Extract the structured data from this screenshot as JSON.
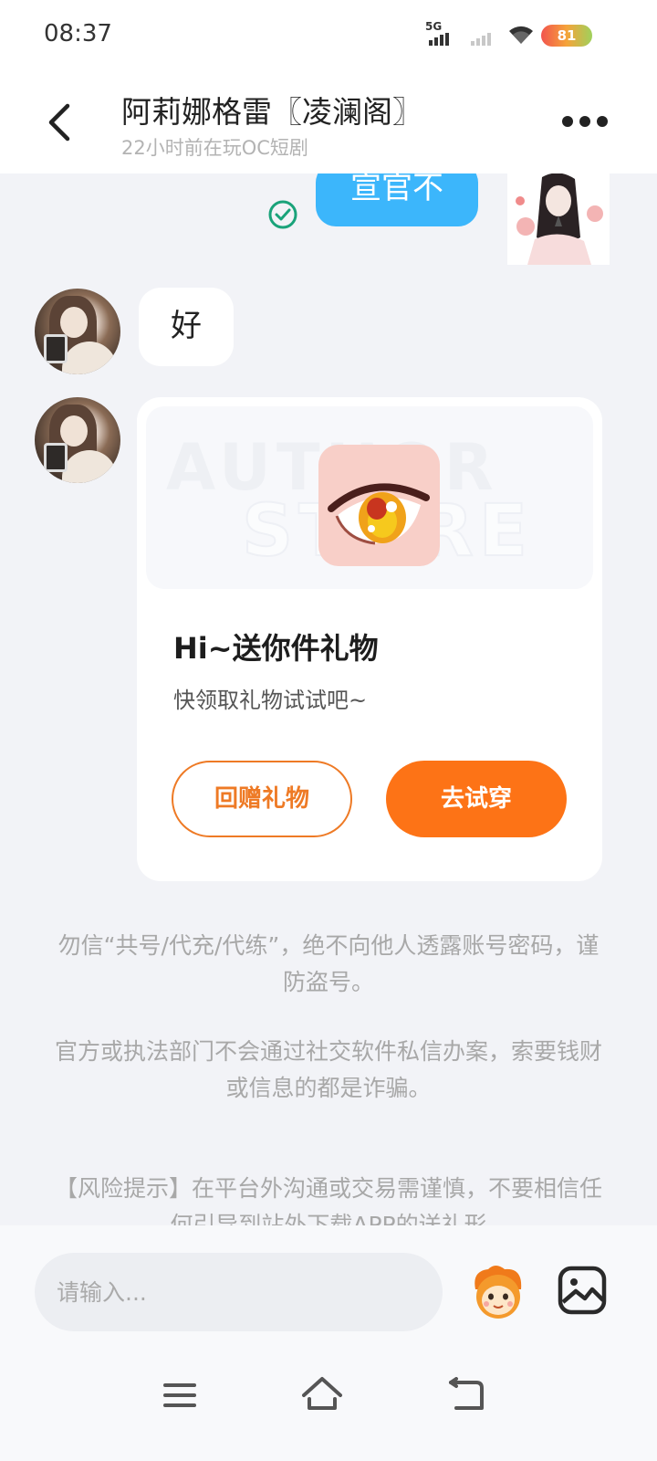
{
  "status_bar": {
    "time": "08:37",
    "network": "5G",
    "battery": "81"
  },
  "header": {
    "title": "阿莉娜格雷〖凌澜阁〗",
    "subtitle": "22小时前在玩OC短剧"
  },
  "messages": {
    "sent_text": "宣官不",
    "received_text": "好"
  },
  "gift_card": {
    "watermark_line1": "AUTHOR",
    "watermark_line2": "STORE",
    "title": "Hi~送你件礼物",
    "description": "快领取礼物试试吧~",
    "return_gift_label": "回赠礼物",
    "try_on_label": "去试穿"
  },
  "notices": {
    "line1": "勿信“共号/代充/代练”，绝不向他人透露账号密码，谨防盗号。",
    "line2": "官方或执法部门不会通过社交软件私信办案，索要钱财或信息的都是诈骗。",
    "line3": "【风险提示】在平台外沟通或交易需谨慎，不要相信任何引导到站外下载APP的送礼形"
  },
  "input_bar": {
    "placeholder": "请输入..."
  },
  "icons": {
    "back": "chevron-left-icon",
    "more": "more-dots-icon",
    "sent_status": "check-circle-icon",
    "emoji": "mascot-emoji-icon",
    "image": "image-icon",
    "nav_menu": "menu-icon",
    "nav_home": "home-icon",
    "nav_back": "back-nav-icon"
  },
  "colors": {
    "accent_orange": "#fd7316",
    "sent_bubble_blue": "#3cb6fb",
    "check_green": "#1aa37a"
  }
}
